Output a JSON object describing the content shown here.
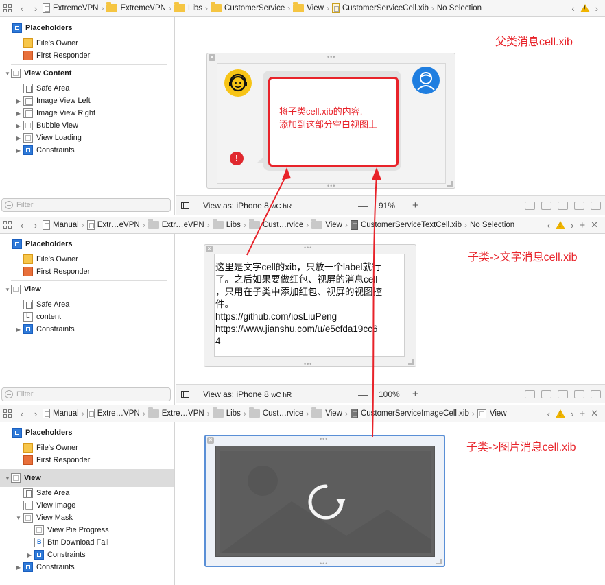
{
  "pane1": {
    "crumbs": [
      "ExtremeVPN",
      "ExtremeVPN",
      "Libs",
      "CustomerService",
      "View",
      "CustomerServiceCell.xib",
      "No Selection"
    ],
    "outline": {
      "placeholders": "Placeholders",
      "files_owner": "File's Owner",
      "first_responder": "First Responder",
      "view_content": "View Content",
      "safe_area": "Safe Area",
      "image_view_left": "Image View Left",
      "image_view_right": "Image View Right",
      "bubble_view": "Bubble View",
      "view_loading": "View Loading",
      "constraints": "Constraints"
    },
    "filter_placeholder": "Filter",
    "view_as": "View as: iPhone 8",
    "size_class": "wC hR",
    "zoom": "91%",
    "bubble_text_line1": "将子类cell.xib的内容,",
    "bubble_text_line2": "添加到这部分空白视图上",
    "error_glyph": "!",
    "annotation": "父类消息cell.xib"
  },
  "pane2": {
    "crumbs": [
      "Manual",
      "Extr…eVPN",
      "Extr…eVPN",
      "Libs",
      "Cust…rvice",
      "View",
      "CustomerServiceTextCell.xib",
      "No Selection"
    ],
    "outline": {
      "placeholders": "Placeholders",
      "files_owner": "File's Owner",
      "first_responder": "First Responder",
      "view": "View",
      "safe_area": "Safe Area",
      "content": "content",
      "constraints": "Constraints"
    },
    "filter_placeholder": "Filter",
    "view_as": "View as: iPhone 8",
    "size_class": "wC hR",
    "zoom": "100%",
    "text_lines": [
      "这里是文字cell的xib，只放一个label就行",
      "了。之后如果要做红包、视屏的消息cell",
      "，只用在子类中添加红包、视屏的视图控",
      "件。",
      "https://github.com/iosLiuPeng",
      "https://www.jianshu.com/u/e5cfda19cc6",
      "4"
    ],
    "annotation": "子类->文字消息cell.xib"
  },
  "pane3": {
    "crumbs": [
      "Manual",
      "Extre…VPN",
      "Extre…VPN",
      "Libs",
      "Cust…rvice",
      "View",
      "CustomerServiceImageCell.xib",
      "View"
    ],
    "outline": {
      "placeholders": "Placeholders",
      "files_owner": "File's Owner",
      "first_responder": "First Responder",
      "view": "View",
      "safe_area": "Safe Area",
      "view_image": "View Image",
      "view_mask": "View Mask",
      "view_pie_progress": "View Pie Progress",
      "btn_download_fail": "Btn Download Fail",
      "constraints_inner": "Constraints",
      "constraints": "Constraints"
    },
    "annotation": "子类->图片消息cell.xib"
  },
  "colors": {
    "annotation": "#e8232a",
    "arrow": "#e8232a",
    "selection": "#2f7ad8",
    "folder": "#f5c542",
    "avatar_left": "#f7c416",
    "avatar_right": "#1f7ee0"
  }
}
